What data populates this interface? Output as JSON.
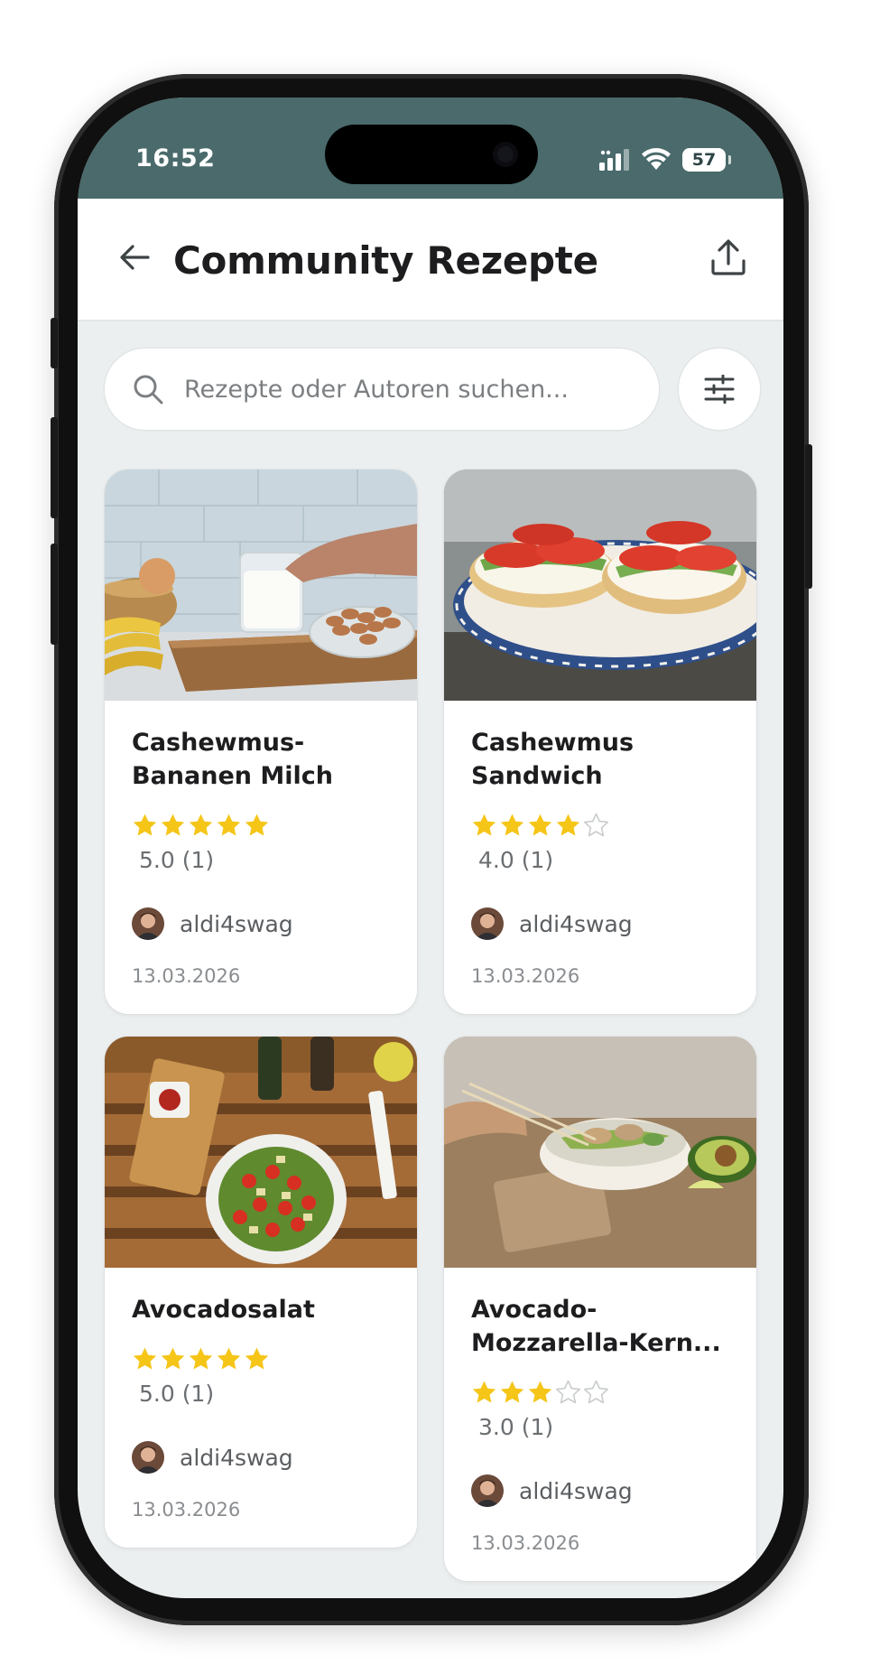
{
  "status_bar": {
    "time": "16:52",
    "battery": "57"
  },
  "header": {
    "title": "Community Rezepte"
  },
  "search": {
    "placeholder": "Rezepte oder Autoren suchen..."
  },
  "recipes": [
    {
      "title_line1": "Cashewmus-",
      "title_line2": "Bananen Milch",
      "stars": 5,
      "rating": "5.0 (1)",
      "author": "aldi4swag",
      "date": "13.03.2026",
      "image": "milk-bananas-almonds"
    },
    {
      "title_line1": "Cashewmus",
      "title_line2": "Sandwich",
      "stars": 4,
      "rating": "4.0 (1)",
      "author": "aldi4swag",
      "date": "13.03.2026",
      "image": "tomato-sandwiches"
    },
    {
      "title_line1": "Avocadosalat",
      "title_line2": "",
      "stars": 5,
      "rating": "5.0 (1)",
      "author": "aldi4swag",
      "date": "13.03.2026",
      "image": "tomato-salad-bowl"
    },
    {
      "title_line1": "Avocado-",
      "title_line2": "Mozzarella-Kern...",
      "stars": 3,
      "rating": "3.0 (1)",
      "author": "aldi4swag",
      "date": "13.03.2026",
      "image": "noodle-bowl-avocado"
    }
  ],
  "colors": {
    "status_bar": "#4a6a6b",
    "star_filled": "#f5c518",
    "star_empty": "#c9ccce",
    "background": "#eceff0"
  },
  "icons": {
    "back": "arrow-left-icon",
    "share": "share-upload-icon",
    "search": "search-icon",
    "filter": "sliders-icon"
  }
}
